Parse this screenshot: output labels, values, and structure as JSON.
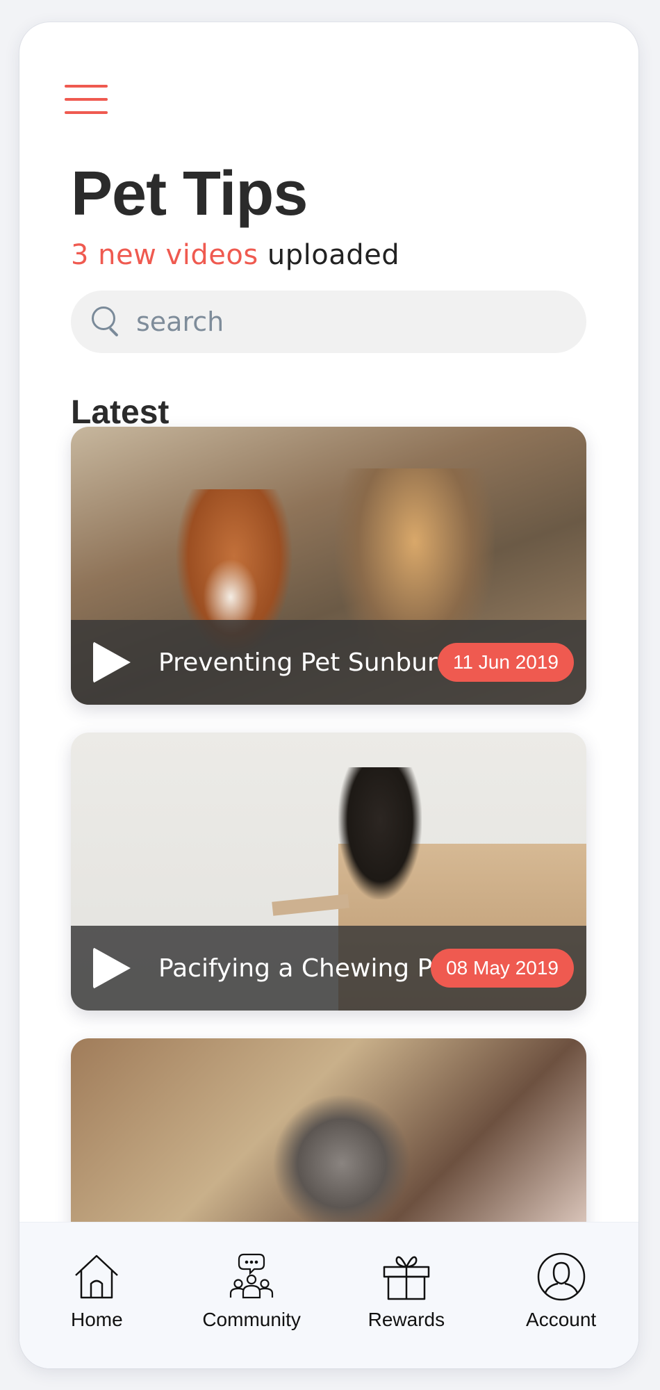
{
  "header": {
    "menu_icon": "hamburger-menu-icon",
    "title": "Pet Tips",
    "subtitle_highlight": "3 new videos",
    "subtitle_rest": " uploaded"
  },
  "search": {
    "placeholder": "search",
    "icon": "search-icon"
  },
  "section_title": "Latest",
  "videos": [
    {
      "title": "Preventing Pet Sunburn",
      "date": "11 Jun 2019"
    },
    {
      "title": "Pacifying a Chewing Pup",
      "date": "08 May 2019"
    }
  ],
  "tabbar": {
    "items": [
      {
        "label": "Home",
        "icon": "home-icon"
      },
      {
        "label": "Community",
        "icon": "community-icon"
      },
      {
        "label": "Rewards",
        "icon": "gift-icon"
      },
      {
        "label": "Account",
        "icon": "account-icon"
      }
    ]
  },
  "colors": {
    "accent": "#ef5a50",
    "text": "#2b2b2b",
    "search_bg": "#f1f1f1",
    "tabbar_bg": "#f6f8fc"
  }
}
